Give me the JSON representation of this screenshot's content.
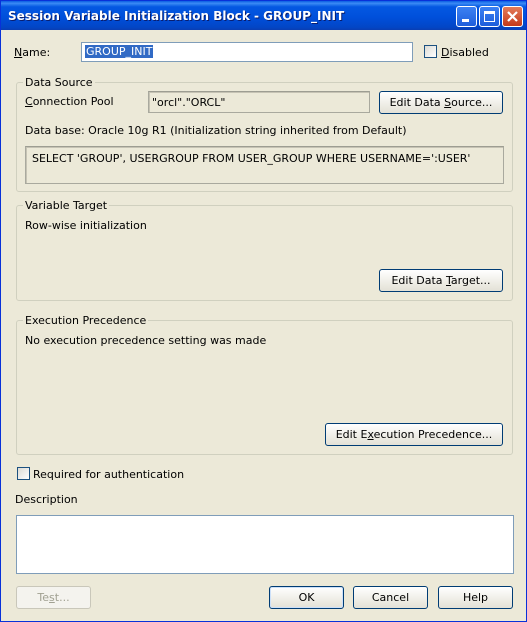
{
  "window": {
    "title": "Session Variable Initialization Block - GROUP_INIT"
  },
  "name_field": {
    "label_u": "N",
    "label_rest": "ame:",
    "value": "GROUP_INIT"
  },
  "disabled": {
    "label_u": "D",
    "label_rest": "isabled",
    "checked": false
  },
  "data_source": {
    "title": "Data Source",
    "conn_label_u": "C",
    "conn_label_rest": "onnection Pool",
    "conn_value": "\"orcl\".\"ORCL\"",
    "edit_button_pre": "Edit Data ",
    "edit_button_u": "S",
    "edit_button_post": "ource...",
    "database_info": "Data base: Oracle 10g R1 (Initialization string inherited from Default)",
    "sql": "SELECT 'GROUP', USERGROUP FROM USER_GROUP WHERE USERNAME=':USER'"
  },
  "variable_target": {
    "title": "Variable Target",
    "info": "Row-wise initialization",
    "edit_button_pre": "Edit Data ",
    "edit_button_u": "T",
    "edit_button_post": "arget..."
  },
  "execution_precedence": {
    "title": "Execution Precedence",
    "info": "No execution precedence setting was made",
    "edit_button_pre": "Edit E",
    "edit_button_u": "x",
    "edit_button_post": "ecution Precedence..."
  },
  "required_auth": {
    "label": "Required for authentication",
    "checked": false
  },
  "description": {
    "label": "Description",
    "value": ""
  },
  "buttons": {
    "test_pre": "Te",
    "test_u": "s",
    "test_post": "t...",
    "ok": "OK",
    "cancel": "Cancel",
    "help": "Help"
  }
}
